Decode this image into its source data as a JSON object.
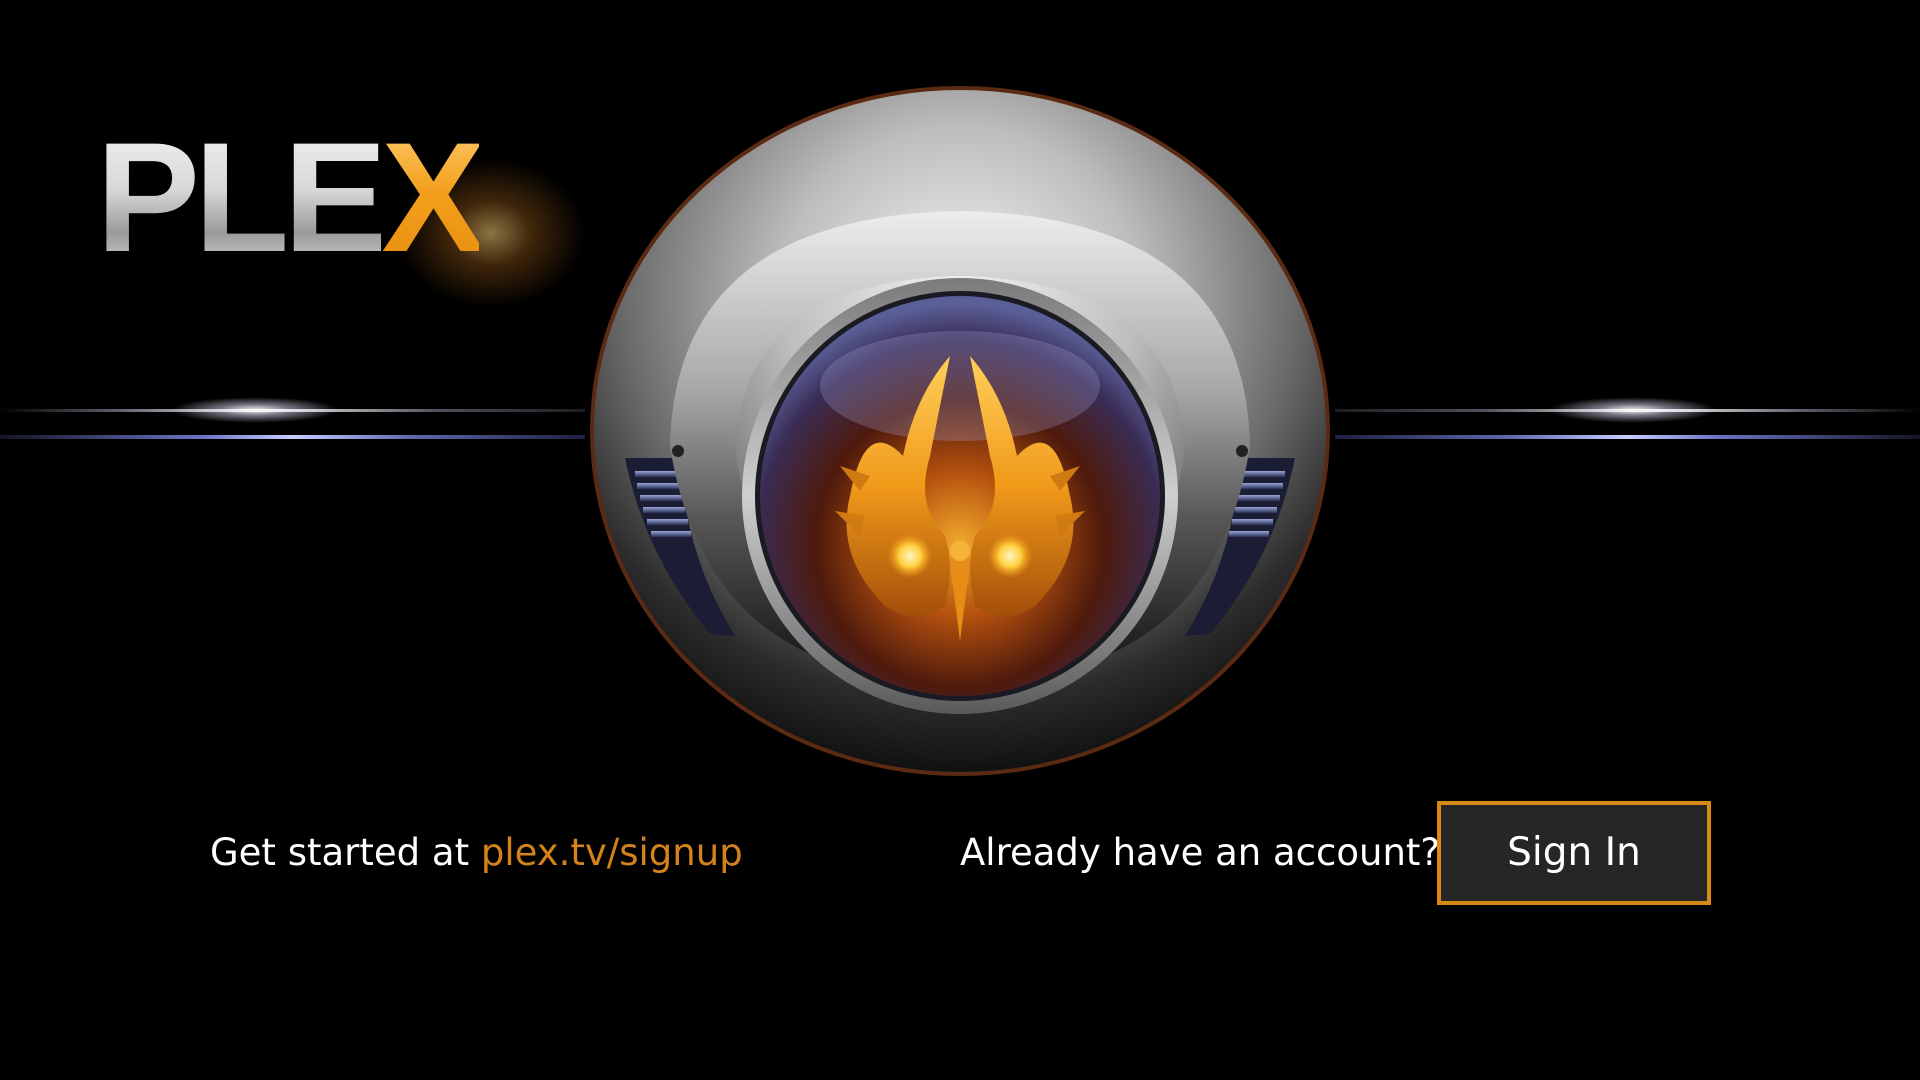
{
  "logo": {
    "text_main": "PLE",
    "text_accent": "X"
  },
  "signup": {
    "prefix": "Get started at",
    "link_text": "plex.tv/signup"
  },
  "signin": {
    "prompt": "Already have an account?",
    "button_label": "Sign In"
  },
  "colors": {
    "accent": "#e5a00d",
    "link": "#d4821a",
    "button_background": "#262626",
    "background": "#000000"
  },
  "icons": {
    "emblem": "phoenix-orb-icon"
  }
}
